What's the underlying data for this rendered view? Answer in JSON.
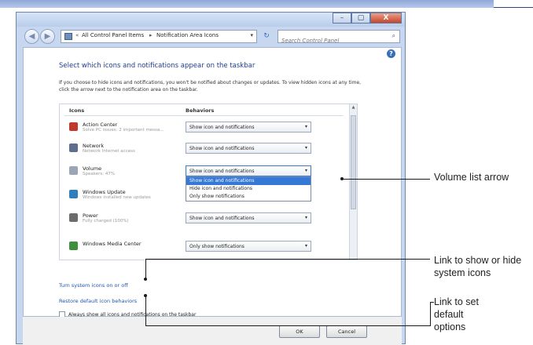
{
  "window": {
    "title_buttons": {
      "minimize": "–",
      "maximize": "▢",
      "close": "X"
    },
    "nav": {
      "back": "◀",
      "forward": "▶"
    },
    "address": {
      "separator1": "«",
      "crumb1": "All Control Panel Items",
      "separator2": "▸",
      "crumb2": "Notification Area Icons",
      "dropdown": "▾",
      "refresh": "↻"
    },
    "search": {
      "placeholder": "Search Control Panel",
      "icon": "search-icon"
    },
    "help_icon": "?"
  },
  "page": {
    "title": "Select which icons and notifications appear on the taskbar",
    "description": "If you choose to hide icons and notifications, you won't be notified about changes or updates. To view hidden icons at any time, click the arrow next to the notification area on the taskbar."
  },
  "table": {
    "columns": {
      "icons": "Icons",
      "behaviors": "Behaviors"
    },
    "rows": [
      {
        "name": "Action Center",
        "subtitle": "Solve PC issues: 2 important messa...",
        "behavior": "Show icon and notifications",
        "icon": "flag-icon",
        "color": "#c0392b"
      },
      {
        "name": "Network",
        "subtitle": "Network Internet access",
        "behavior": "Show icon and notifications",
        "icon": "network-icon",
        "color": "#5b6f8c"
      },
      {
        "name": "Volume",
        "subtitle": "Speakers: 47%",
        "behavior": "Show icon and notifications",
        "icon": "speaker-icon",
        "color": "#9aa5b5"
      },
      {
        "name": "Windows Update",
        "subtitle": "Windows installed new updates",
        "behavior": "",
        "icon": "shield-update-icon",
        "color": "#2f7fbf"
      },
      {
        "name": "Power",
        "subtitle": "Fully charged (100%)",
        "behavior": "Show icon and notifications",
        "icon": "battery-icon",
        "color": "#6c6c6c"
      },
      {
        "name": "Windows Media Center",
        "subtitle": "",
        "behavior": "Only show notifications",
        "icon": "media-center-icon",
        "color": "#3e8f3e"
      }
    ],
    "dropdown_options": [
      "Show icon and notifications",
      "Hide icon and notifications",
      "Only show notifications"
    ],
    "select_arrow": "▾",
    "scroll_up": "▲"
  },
  "links": {
    "system_icons": "Turn system icons on or off",
    "restore_defaults": "Restore default icon behaviors"
  },
  "always_show": {
    "label": "Always show all icons and notifications on the taskbar",
    "checked": false
  },
  "buttons": {
    "ok": "OK",
    "cancel": "Cancel"
  },
  "callouts": [
    "Volume list arrow",
    "Link to show or hide system icons",
    "Link to set default options"
  ]
}
